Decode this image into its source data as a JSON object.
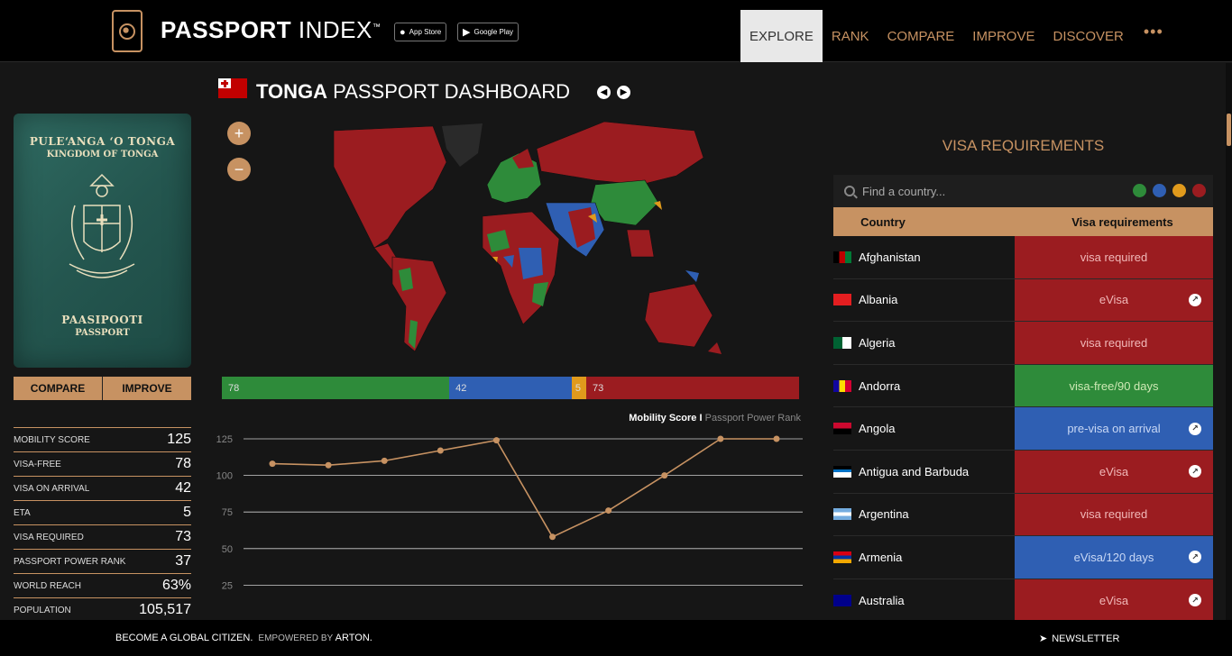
{
  "header": {
    "brand_bold": "PASSPORT",
    "brand_light": "INDEX",
    "brand_tm": "™",
    "app_store": "App Store",
    "google_play": "Google Play",
    "nav": [
      "EXPLORE",
      "RANK",
      "COMPARE",
      "IMPROVE",
      "DISCOVER"
    ],
    "nav_active": "EXPLORE",
    "more": "•••"
  },
  "passport": {
    "line1": "PULEʻANGA ʻO TONGA",
    "line2": "KINGDOM OF TONGA",
    "line3": "PAASIPOOTI",
    "line4": "PASSPORT"
  },
  "left_buttons": {
    "compare": "COMPARE",
    "improve": "IMPROVE"
  },
  "stats": [
    {
      "label": "MOBILITY SCORE",
      "value": "125"
    },
    {
      "label": "VISA-FREE",
      "value": "78"
    },
    {
      "label": "VISA ON ARRIVAL",
      "value": "42"
    },
    {
      "label": "ETA",
      "value": "5"
    },
    {
      "label": "VISA REQUIRED",
      "value": "73"
    },
    {
      "label": "PASSPORT POWER RANK",
      "value": "37"
    },
    {
      "label": "WORLD REACH",
      "value": "63%"
    },
    {
      "label": "POPULATION",
      "value": "105,517"
    }
  ],
  "dashboard": {
    "title_bold": "TONGA",
    "title_rest": "PASSPORT DASHBOARD"
  },
  "zoom": {
    "in": "+",
    "out": "−"
  },
  "colors": {
    "accent": "#c79262",
    "visa_free": "#2e8b3a",
    "on_arrival": "#2f5fb3",
    "eta": "#e09a1c",
    "required": "#9b1c20"
  },
  "breakdown": [
    {
      "label": "78",
      "value": 78,
      "color": "#2e8b3a"
    },
    {
      "label": "42",
      "value": 42,
      "color": "#2f5fb3"
    },
    {
      "label": "5",
      "value": 5,
      "color": "#e09a1c"
    },
    {
      "label": "73",
      "value": 73,
      "color": "#9b1c20"
    }
  ],
  "chart_legend": {
    "primary": "Mobility Score",
    "separator": "I",
    "secondary": "Passport Power Rank"
  },
  "chart_data": {
    "type": "line",
    "x": [
      1,
      2,
      3,
      4,
      5,
      6,
      7,
      8,
      9,
      10
    ],
    "series": [
      {
        "name": "Mobility Score",
        "values": [
          108,
          107,
          110,
          117,
          124,
          58,
          76,
          100,
          125,
          125
        ]
      }
    ],
    "yticks": [
      125,
      100,
      75,
      50,
      25
    ],
    "ylim": [
      0,
      125
    ],
    "grid": true,
    "line_color": "#c79262"
  },
  "visa": {
    "title": "VISA REQUIREMENTS",
    "search_placeholder": "Find a country...",
    "filter_dots": [
      "#2e8b3a",
      "#2f5fb3",
      "#e09a1c",
      "#9b1c20"
    ],
    "col_country": "Country",
    "col_req": "Visa requirements",
    "rows": [
      {
        "country": "Afghanistan",
        "req": "visa required",
        "kind": "required",
        "link": false
      },
      {
        "country": "Albania",
        "req": "eVisa",
        "kind": "required",
        "link": true
      },
      {
        "country": "Algeria",
        "req": "visa required",
        "kind": "required",
        "link": false
      },
      {
        "country": "Andorra",
        "req": "visa-free/90 days",
        "kind": "free",
        "link": false
      },
      {
        "country": "Angola",
        "req": "pre-visa on arrival",
        "kind": "arrival",
        "link": true
      },
      {
        "country": "Antigua and Barbuda",
        "req": "eVisa",
        "kind": "required",
        "link": true
      },
      {
        "country": "Argentina",
        "req": "visa required",
        "kind": "required",
        "link": false
      },
      {
        "country": "Armenia",
        "req": "eVisa/120 days",
        "kind": "arrival",
        "link": true
      },
      {
        "country": "Australia",
        "req": "eVisa",
        "kind": "required",
        "link": true
      }
    ]
  },
  "footer": {
    "left": "BECOME A GLOBAL CITIZEN.",
    "powered": "EMPOWERED BY",
    "arton": "ARTON.",
    "newsletter": "NEWSLETTER"
  }
}
